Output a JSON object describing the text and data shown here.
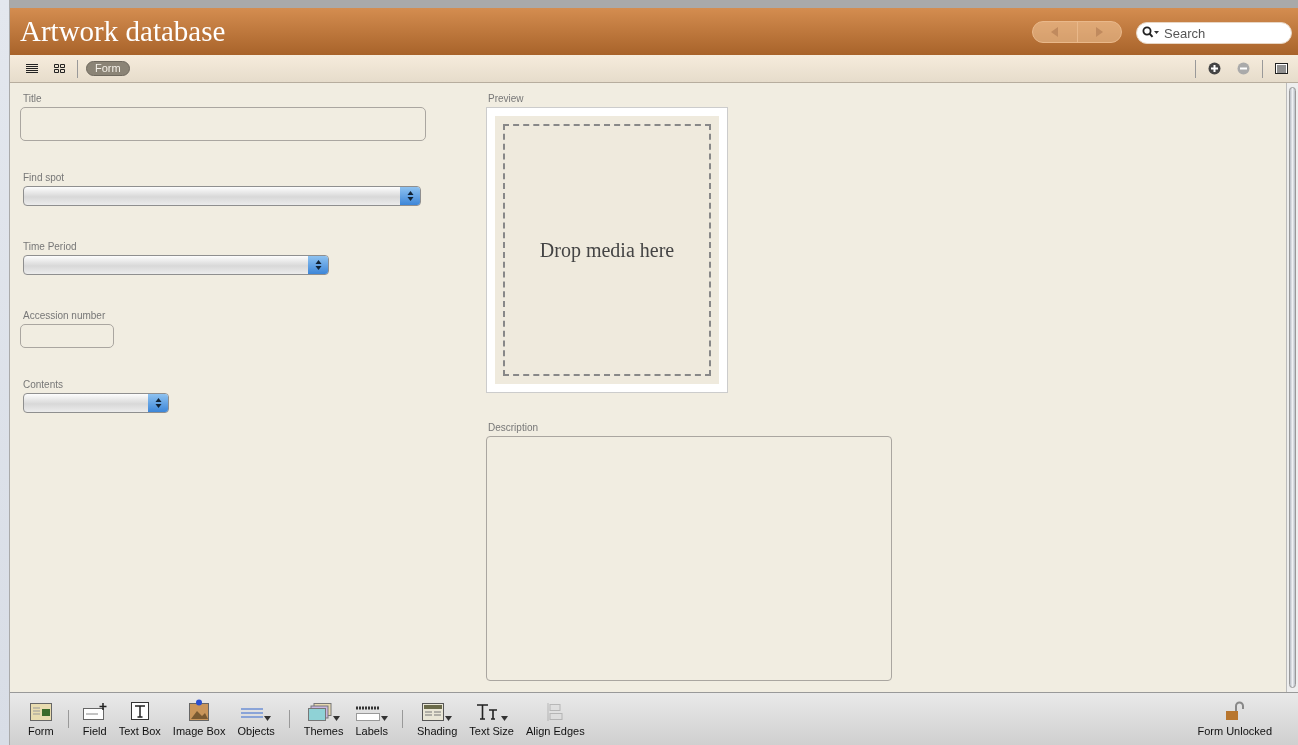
{
  "window": {
    "title": "Artwork database"
  },
  "navigation": {
    "back_disabled": true,
    "forward_disabled": true
  },
  "search": {
    "placeholder": "Search"
  },
  "view_bar": {
    "views": [
      {
        "kind": "list",
        "selected": false
      },
      {
        "kind": "grid",
        "selected": false
      },
      {
        "kind": "form",
        "label": "Form",
        "selected": true
      }
    ],
    "add_disabled": false,
    "remove_disabled": true
  },
  "left_fields": [
    {
      "label": "Title",
      "kind": "text"
    },
    {
      "label": "Find spot",
      "kind": "popup"
    },
    {
      "label": "Time Period",
      "kind": "popup"
    },
    {
      "label": "Accession number",
      "kind": "text"
    },
    {
      "label": "Contents",
      "kind": "popup"
    }
  ],
  "preview": {
    "label": "Preview",
    "drop_text": "Drop media here"
  },
  "description": {
    "label": "Description"
  },
  "toolbar": {
    "groups": [
      [
        {
          "label": "Form",
          "kind": "form",
          "menu": false,
          "disabled": false
        }
      ],
      [
        {
          "label": "Field",
          "kind": "field",
          "menu": false,
          "disabled": false
        },
        {
          "label": "Text Box",
          "kind": "textbox",
          "menu": false,
          "disabled": false
        },
        {
          "label": "Image Box",
          "kind": "imagebox",
          "menu": false,
          "disabled": false
        },
        {
          "label": "Objects",
          "kind": "objects",
          "menu": true,
          "disabled": false
        }
      ],
      [
        {
          "label": "Themes",
          "kind": "themes",
          "menu": true,
          "disabled": false
        },
        {
          "label": "Labels",
          "kind": "labels",
          "menu": true,
          "disabled": false
        }
      ],
      [
        {
          "label": "Shading",
          "kind": "shading",
          "menu": true,
          "disabled": false
        },
        {
          "label": "Text Size",
          "kind": "textsize",
          "menu": true,
          "disabled": false
        },
        {
          "label": "Align Edges",
          "kind": "align",
          "menu": false,
          "disabled": true
        }
      ]
    ],
    "lock": {
      "label": "Form Unlocked",
      "locked": false
    }
  }
}
